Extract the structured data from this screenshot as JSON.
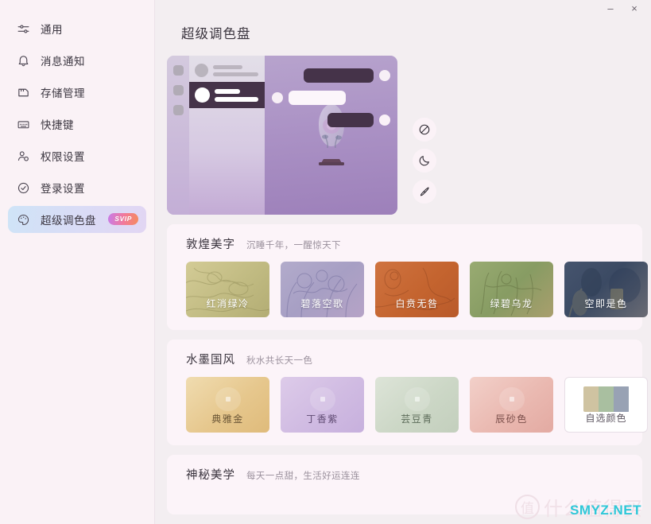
{
  "window": {
    "minimize_label": "–",
    "close_label": "×"
  },
  "sidebar": {
    "items": [
      {
        "label": "通用",
        "icon": "sliders-icon",
        "active": false,
        "badge": null
      },
      {
        "label": "消息通知",
        "icon": "bell-icon",
        "active": false,
        "badge": null
      },
      {
        "label": "存储管理",
        "icon": "storage-icon",
        "active": false,
        "badge": null
      },
      {
        "label": "快捷键",
        "icon": "keyboard-icon",
        "active": false,
        "badge": null
      },
      {
        "label": "权限设置",
        "icon": "user-settings-icon",
        "active": false,
        "badge": null
      },
      {
        "label": "登录设置",
        "icon": "check-circle-icon",
        "active": false,
        "badge": null
      },
      {
        "label": "超级调色盘",
        "icon": "palette-icon",
        "active": true,
        "badge": "SVIP"
      }
    ]
  },
  "header": {
    "title": "超级调色盘"
  },
  "preview": {
    "mode_buttons": [
      {
        "name": "no-theme-icon",
        "label": "关闭"
      },
      {
        "name": "moon-icon",
        "label": "深色"
      },
      {
        "name": "brush-icon",
        "label": "自定义"
      }
    ]
  },
  "sections": [
    {
      "title": "敦煌美字",
      "subtitle": "沉睡千年，一醒惊天下",
      "cards": [
        {
          "label": "红消绿冷",
          "style": "mural",
          "c1": "#c9c08b",
          "c2": "#b5b07e",
          "c3": "#d8cf9d"
        },
        {
          "label": "碧落空歌",
          "style": "mural",
          "c1": "#a9a4c6",
          "c2": "#9e9ac0",
          "c3": "#c3bcd6"
        },
        {
          "label": "白贲无咎",
          "style": "mural",
          "c1": "#c96a3a",
          "c2": "#b85c2f",
          "c3": "#d98a52"
        },
        {
          "label": "绿碧乌龙",
          "style": "mural",
          "c1": "#8aa06a",
          "c2": "#7d955f",
          "c3": "#a5b484"
        },
        {
          "label": "空即是色",
          "style": "mural",
          "c1": "#4a5a74",
          "c2": "#3e4d66",
          "c3": "#6b7a90"
        }
      ]
    },
    {
      "title": "水墨国风",
      "subtitle": "秋水共长天一色",
      "cards": [
        {
          "label": "典雅金",
          "style": "solid",
          "c1": "#e9cf9c",
          "c2": "#e0c083"
        },
        {
          "label": "丁香紫",
          "style": "solid",
          "c1": "#d7c3e4",
          "c2": "#c9b2dd"
        },
        {
          "label": "芸豆青",
          "style": "solid",
          "c1": "#d5ded0",
          "c2": "#c5d2bf"
        },
        {
          "label": "辰砂色",
          "style": "solid",
          "c1": "#eec6c0",
          "c2": "#e6b3ab"
        },
        {
          "label": "自选颜色",
          "style": "custom",
          "swatches": [
            "#cfc3a1",
            "#a9bfa0",
            "#98a2b4"
          ]
        }
      ]
    },
    {
      "title": "神秘美学",
      "subtitle": "每天一点甜，生活好运连连",
      "cards": []
    }
  ],
  "watermark": {
    "mark": "值",
    "text": "什么值得买",
    "site": "SMYZ.NET"
  }
}
